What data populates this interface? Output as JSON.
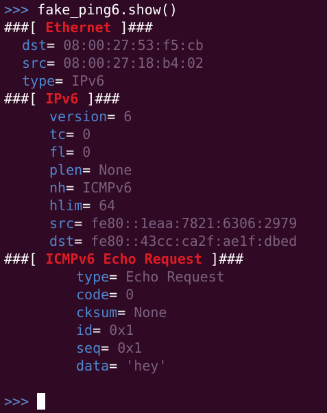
{
  "terminal": {
    "prompt": ">>>",
    "command": "fake_ping6.show()",
    "hdr_open": "###[ ",
    "hdr_close": " ]###",
    "eq": "=",
    "layers": [
      {
        "name": "Ethernet",
        "fields": [
          {
            "key": "dst",
            "value": "08:00:27:53:f5:cb"
          },
          {
            "key": "src",
            "value": "08:00:27:18:b4:02"
          },
          {
            "key": "type",
            "value": "IPv6"
          }
        ]
      },
      {
        "name": "IPv6",
        "fields": [
          {
            "key": "version",
            "value": "6"
          },
          {
            "key": "tc",
            "value": "0"
          },
          {
            "key": "fl",
            "value": "0"
          },
          {
            "key": "plen",
            "value": "None"
          },
          {
            "key": "nh",
            "value": "ICMPv6"
          },
          {
            "key": "hlim",
            "value": "64"
          },
          {
            "key": "src",
            "value": "fe80::1eaa:7821:6306:2979"
          },
          {
            "key": "dst",
            "value": "fe80::43cc:ca2f:ae1f:dbed"
          }
        ]
      },
      {
        "name": "ICMPv6 Echo Request",
        "fields": [
          {
            "key": "type",
            "value": "Echo Request"
          },
          {
            "key": "code",
            "value": "0"
          },
          {
            "key": "cksum",
            "value": "None"
          },
          {
            "key": "id",
            "value": "0x1"
          },
          {
            "key": "seq",
            "value": "0x1"
          },
          {
            "key": "data",
            "value": "'hey'"
          }
        ]
      }
    ]
  },
  "colors": {
    "background": "#300a24",
    "prompt": "#5b8fd6",
    "layer_name": "#e01b24",
    "field_key": "#4f86cf",
    "field_value": "#7a5f7f",
    "text": "#ffffff"
  }
}
